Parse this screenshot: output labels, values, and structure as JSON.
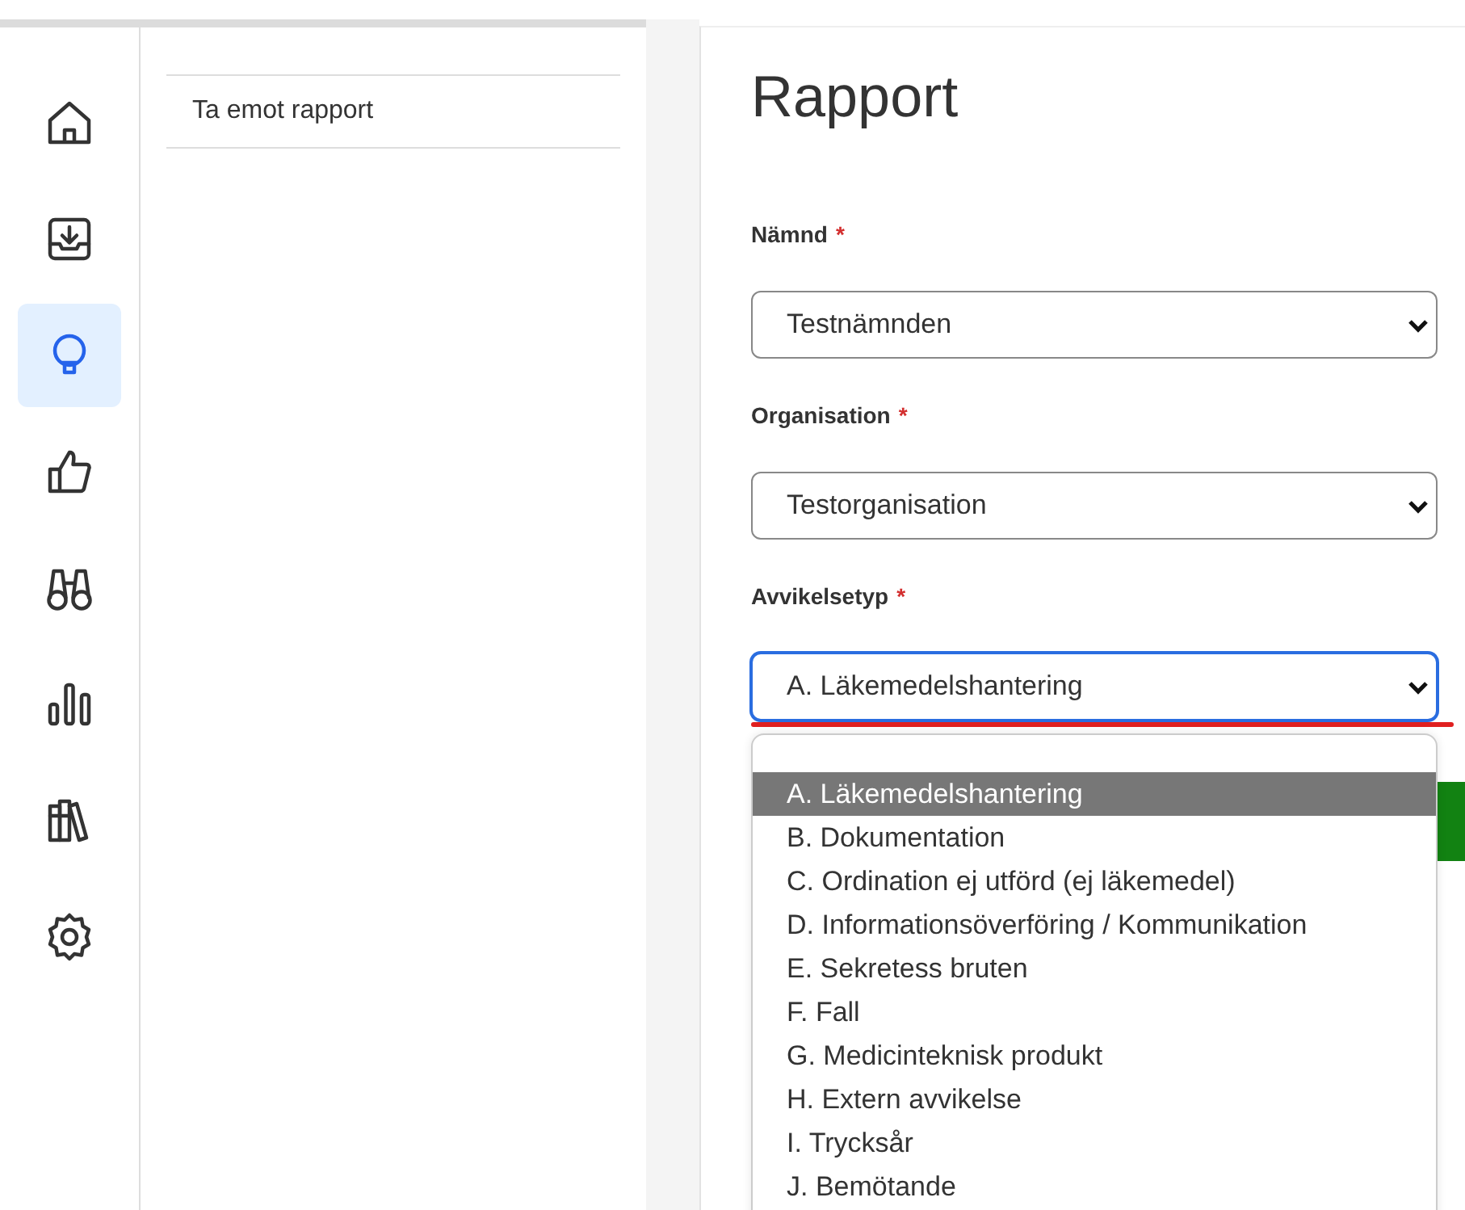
{
  "sidebar": {
    "items": [
      {
        "selected": false
      },
      {
        "selected": false
      },
      {
        "selected": true
      },
      {
        "selected": false
      },
      {
        "selected": false
      },
      {
        "selected": false
      },
      {
        "selected": false
      },
      {
        "selected": false
      }
    ]
  },
  "subnav": {
    "items": [
      "Ta emot rapport"
    ]
  },
  "form": {
    "title": "Rapport",
    "fields": [
      {
        "label": "Nämnd",
        "required_mark": "*",
        "value": "Testnämnden",
        "focused": false
      },
      {
        "label": "Organisation",
        "required_mark": "*",
        "value": "Testorganisation",
        "focused": false
      },
      {
        "label": "Avvikelsetyp",
        "required_mark": "*",
        "value": "A. Läkemedelshantering",
        "focused": true
      }
    ],
    "open_list": {
      "options": [
        {
          "label": "A. Läkemedelshantering",
          "selected": true
        },
        {
          "label": "B. Dokumentation",
          "selected": false
        },
        {
          "label": "C. Ordination ej utförd (ej läkemedel)",
          "selected": false
        },
        {
          "label": "D. Informationsöverföring / Kommunikation",
          "selected": false
        },
        {
          "label": "E. Sekretess bruten",
          "selected": false
        },
        {
          "label": "F. Fall",
          "selected": false
        },
        {
          "label": "G. Medicinteknisk produkt",
          "selected": false
        },
        {
          "label": "H. Extern avvikelse",
          "selected": false
        },
        {
          "label": "I. Trycksår",
          "selected": false
        },
        {
          "label": "J. Bemötande",
          "selected": false
        }
      ]
    }
  }
}
